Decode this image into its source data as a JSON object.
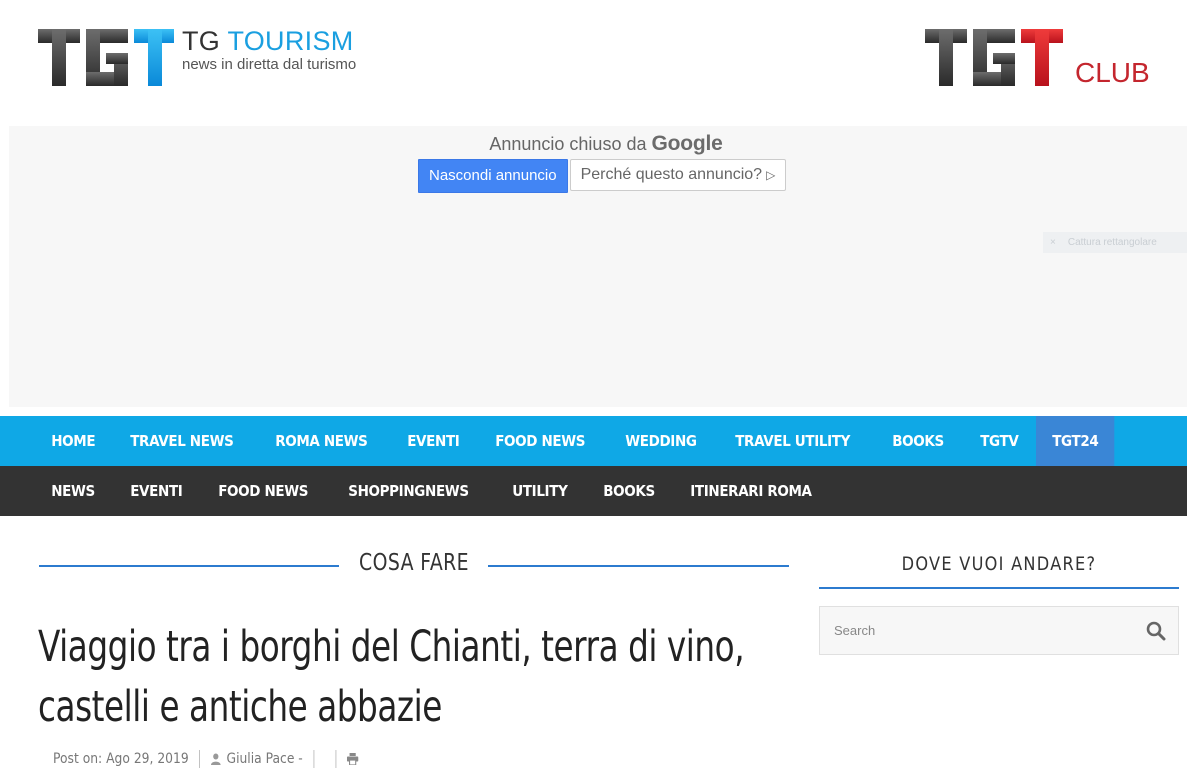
{
  "header": {
    "brand_tg": "TG",
    "brand_tourism": "TOURISM",
    "tagline": "news in diretta dal turismo",
    "club_label": "CLUB",
    "colors": {
      "blue": "#1a9fe0",
      "red": "#c4262e",
      "dark": "#333333"
    }
  },
  "ad": {
    "closed_text": "Annuncio chiuso da",
    "google_label": "Google",
    "hide_button": "Nascondi annuncio",
    "why_button": "Perché questo annuncio?",
    "why_icon": "▷",
    "capture_close": "×",
    "capture_label": "Cattura rettangolare"
  },
  "nav_primary": {
    "items": [
      "HOME",
      "TRAVEL NEWS",
      "ROMA NEWS",
      "EVENTI",
      "FOOD NEWS",
      "WEDDING",
      "TRAVEL UTILITY",
      "BOOKS",
      "TGTV",
      "TGT24"
    ],
    "active": "TGT24",
    "color": "#0fa8e6"
  },
  "nav_secondary": {
    "items": [
      "NEWS",
      "EVENTI",
      "FOOD NEWS",
      "SHOPPINGNEWS",
      "UTILITY",
      "BOOKS",
      "ITINERARI ROMA"
    ],
    "color": "#333333"
  },
  "article": {
    "category": "COSA FARE",
    "title_line1": "Viaggio tra i borghi del Chianti, terra di vino,",
    "title_line2": "castelli e antiche abbazie",
    "posted_label": "Post on:",
    "date": "Ago 29, 2019",
    "author": "Giulia Pace -"
  },
  "sidebar": {
    "title": "DOVE VUOI ANDARE?",
    "search_placeholder": "Search",
    "accent": "#2c7bcf"
  }
}
